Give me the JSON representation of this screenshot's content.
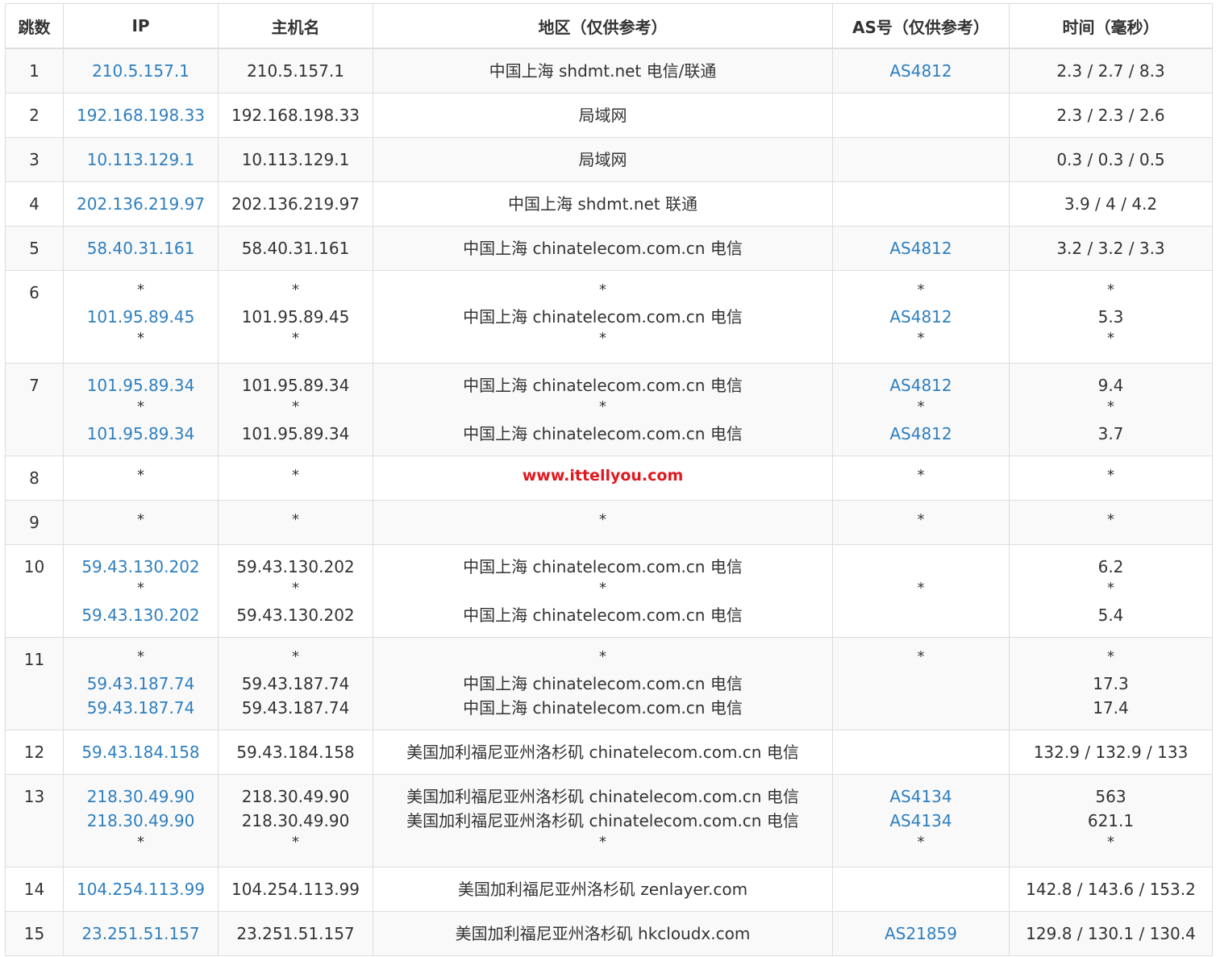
{
  "headers": {
    "hop": "跳数",
    "ip": "IP",
    "host": "主机名",
    "region": "地区（仅供参考）",
    "as": "AS号（仅供参考）",
    "time": "时间（毫秒）"
  },
  "watermark": "www.ittellyou.com",
  "colors": {
    "link": "#2f7fbf",
    "watermark": "#e0191f",
    "stripe": "#f9f9f9",
    "border": "#dddddd"
  },
  "rows": [
    {
      "hop": "1",
      "ip": [
        "210.5.157.1"
      ],
      "host": [
        "210.5.157.1"
      ],
      "region": [
        "中国上海 shdmt.net 电信/联通"
      ],
      "as": [
        "AS4812"
      ],
      "time": [
        "2.3 / 2.7 / 8.3"
      ]
    },
    {
      "hop": "2",
      "ip": [
        "192.168.198.33"
      ],
      "host": [
        "192.168.198.33"
      ],
      "region": [
        "局域网"
      ],
      "as": [
        ""
      ],
      "time": [
        "2.3 / 2.3 / 2.6"
      ]
    },
    {
      "hop": "3",
      "ip": [
        "10.113.129.1"
      ],
      "host": [
        "10.113.129.1"
      ],
      "region": [
        "局域网"
      ],
      "as": [
        ""
      ],
      "time": [
        "0.3 / 0.3 / 0.5"
      ]
    },
    {
      "hop": "4",
      "ip": [
        "202.136.219.97"
      ],
      "host": [
        "202.136.219.97"
      ],
      "region": [
        "中国上海 shdmt.net 联通"
      ],
      "as": [
        ""
      ],
      "time": [
        "3.9 / 4 / 4.2"
      ]
    },
    {
      "hop": "5",
      "ip": [
        "58.40.31.161"
      ],
      "host": [
        "58.40.31.161"
      ],
      "region": [
        "中国上海 chinatelecom.com.cn 电信"
      ],
      "as": [
        "AS4812"
      ],
      "time": [
        "3.2 / 3.2 / 3.3"
      ]
    },
    {
      "hop": "6",
      "ip": [
        "*",
        "101.95.89.45",
        "*"
      ],
      "host": [
        "*",
        "101.95.89.45",
        "*"
      ],
      "region": [
        "*",
        "中国上海 chinatelecom.com.cn 电信",
        "*"
      ],
      "as": [
        "*",
        "AS4812",
        "*"
      ],
      "time": [
        "*",
        "5.3",
        "*"
      ]
    },
    {
      "hop": "7",
      "ip": [
        "101.95.89.34",
        "*",
        "101.95.89.34"
      ],
      "host": [
        "101.95.89.34",
        "*",
        "101.95.89.34"
      ],
      "region": [
        "中国上海 chinatelecom.com.cn 电信",
        "*",
        "中国上海 chinatelecom.com.cn 电信"
      ],
      "as": [
        "AS4812",
        "*",
        "AS4812"
      ],
      "time": [
        "9.4",
        "*",
        "3.7"
      ]
    },
    {
      "hop": "8",
      "ip": [
        "*"
      ],
      "host": [
        "*"
      ],
      "region": [
        "__wm__"
      ],
      "as": [
        "*"
      ],
      "time": [
        "*"
      ]
    },
    {
      "hop": "9",
      "ip": [
        "*"
      ],
      "host": [
        "*"
      ],
      "region": [
        "*"
      ],
      "as": [
        "*"
      ],
      "time": [
        "*"
      ]
    },
    {
      "hop": "10",
      "ip": [
        "59.43.130.202",
        "*",
        "59.43.130.202"
      ],
      "host": [
        "59.43.130.202",
        "*",
        "59.43.130.202"
      ],
      "region": [
        "中国上海 chinatelecom.com.cn 电信",
        "*",
        "中国上海 chinatelecom.com.cn 电信"
      ],
      "as": [
        "",
        "*",
        ""
      ],
      "time": [
        "6.2",
        "*",
        "5.4"
      ]
    },
    {
      "hop": "11",
      "ip": [
        "*",
        "59.43.187.74",
        "59.43.187.74"
      ],
      "host": [
        "*",
        "59.43.187.74",
        "59.43.187.74"
      ],
      "region": [
        "*",
        "中国上海 chinatelecom.com.cn 电信",
        "中国上海 chinatelecom.com.cn 电信"
      ],
      "as": [
        "*",
        "",
        ""
      ],
      "time": [
        "*",
        "17.3",
        "17.4"
      ]
    },
    {
      "hop": "12",
      "ip": [
        "59.43.184.158"
      ],
      "host": [
        "59.43.184.158"
      ],
      "region": [
        "美国加利福尼亚州洛杉矶 chinatelecom.com.cn 电信"
      ],
      "as": [
        ""
      ],
      "time": [
        "132.9 / 132.9 / 133"
      ]
    },
    {
      "hop": "13",
      "ip": [
        "218.30.49.90",
        "218.30.49.90",
        "*"
      ],
      "host": [
        "218.30.49.90",
        "218.30.49.90",
        "*"
      ],
      "region": [
        "美国加利福尼亚州洛杉矶 chinatelecom.com.cn 电信",
        "美国加利福尼亚州洛杉矶 chinatelecom.com.cn 电信",
        "*"
      ],
      "as": [
        "AS4134",
        "AS4134",
        "*"
      ],
      "time": [
        "563",
        "621.1",
        "*"
      ]
    },
    {
      "hop": "14",
      "ip": [
        "104.254.113.99"
      ],
      "host": [
        "104.254.113.99"
      ],
      "region": [
        "美国加利福尼亚州洛杉矶 zenlayer.com"
      ],
      "as": [
        ""
      ],
      "time": [
        "142.8 / 143.6 / 153.2"
      ]
    },
    {
      "hop": "15",
      "ip": [
        "23.251.51.157"
      ],
      "host": [
        "23.251.51.157"
      ],
      "region": [
        "美国加利福尼亚州洛杉矶 hkcloudx.com"
      ],
      "as": [
        "AS21859"
      ],
      "time": [
        "129.8 / 130.1 / 130.4"
      ]
    }
  ]
}
